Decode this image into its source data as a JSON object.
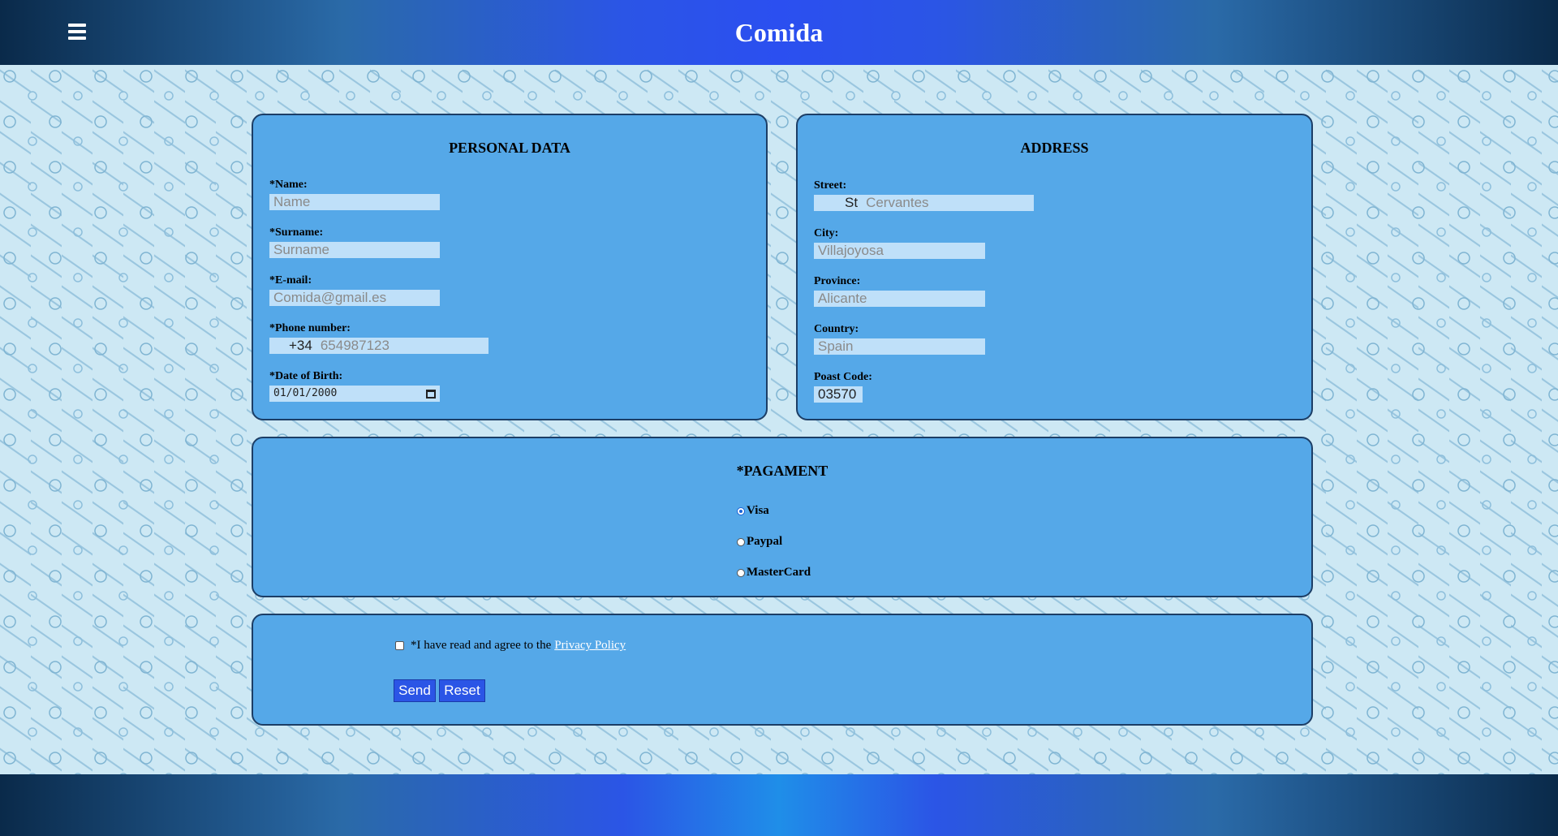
{
  "header": {
    "brand": "Comida",
    "menu_icon": "hamburger-menu-icon"
  },
  "personal": {
    "title": "PERSONAL DATA",
    "name_label": "*Name:",
    "name_placeholder": "Name",
    "surname_label": "*Surname:",
    "surname_placeholder": "Surname",
    "email_label": "*E-mail:",
    "email_placeholder": "Comida@gmail.es",
    "phone_label": "*Phone number:",
    "phone_prefix": "+34",
    "phone_placeholder": "654987123",
    "dob_label": "*Date of Birth:",
    "dob_value": "01/01/2000",
    "dob_icon": "calendar-icon"
  },
  "address": {
    "title": "ADDRESS",
    "street_label": "Street:",
    "street_prefix": "St",
    "street_placeholder": "Cervantes",
    "city_label": "City:",
    "city_placeholder": "Villajoyosa",
    "province_label": "Province:",
    "province_placeholder": "Alicante",
    "country_label": "Country:",
    "country_placeholder": "Spain",
    "postcode_label": "Poast Code:",
    "postcode_value": "03570"
  },
  "payment": {
    "title": "*PAGAMENT",
    "options": [
      "Visa",
      "Paypal",
      "MasterCard"
    ],
    "selected": "Visa"
  },
  "terms": {
    "agree_text": "*I have read and agree to the",
    "policy_link": "Privacy Policy",
    "send_label": "Send",
    "reset_label": "Reset"
  },
  "colors": {
    "panel": "#55a8e8",
    "button": "#2b55e6",
    "field": "#bfe0f9"
  }
}
